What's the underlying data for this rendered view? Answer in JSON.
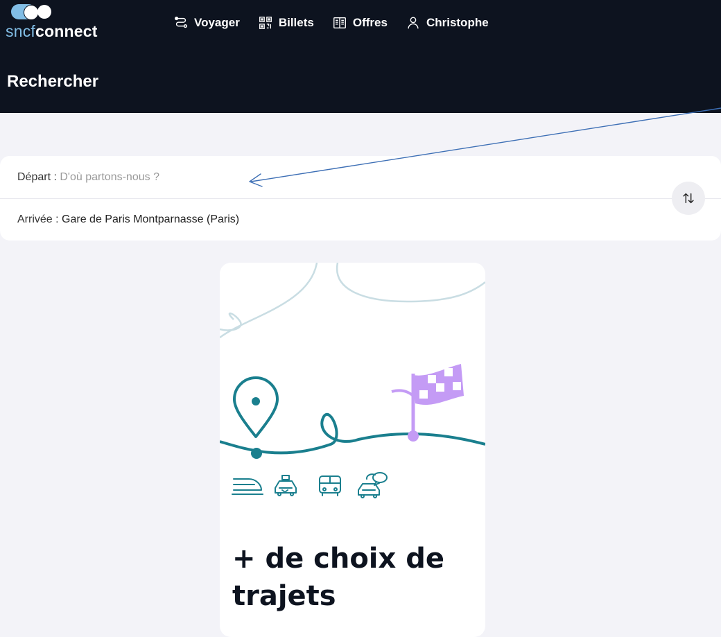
{
  "brand": {
    "logo_prefix": "sncf",
    "logo_suffix": "connect"
  },
  "nav": {
    "items": [
      {
        "label": "Voyager",
        "icon": "route-icon"
      },
      {
        "label": "Billets",
        "icon": "qr-code-icon"
      },
      {
        "label": "Offres",
        "icon": "book-icon"
      },
      {
        "label": "Christophe",
        "icon": "user-icon"
      }
    ]
  },
  "page": {
    "title": "Rechercher"
  },
  "search": {
    "depart_label": "Départ :",
    "depart_placeholder": "D'où partons-nous ?",
    "arrivee_label": "Arrivée :",
    "arrivee_value": "Gare de Paris Montparnasse (Paris)"
  },
  "promo": {
    "heading": "+ de choix de trajets",
    "transport_icons": [
      "train-icon",
      "taxi-icon",
      "bus-icon",
      "carpool-icon"
    ]
  },
  "colors": {
    "header_bg": "#0d131f",
    "page_bg": "#f3f3f8",
    "accent_teal": "#1a7f8e",
    "accent_purple": "#c49bf5",
    "logo_blue": "#82bee6",
    "annotation_arrow": "#3d6fb5"
  }
}
